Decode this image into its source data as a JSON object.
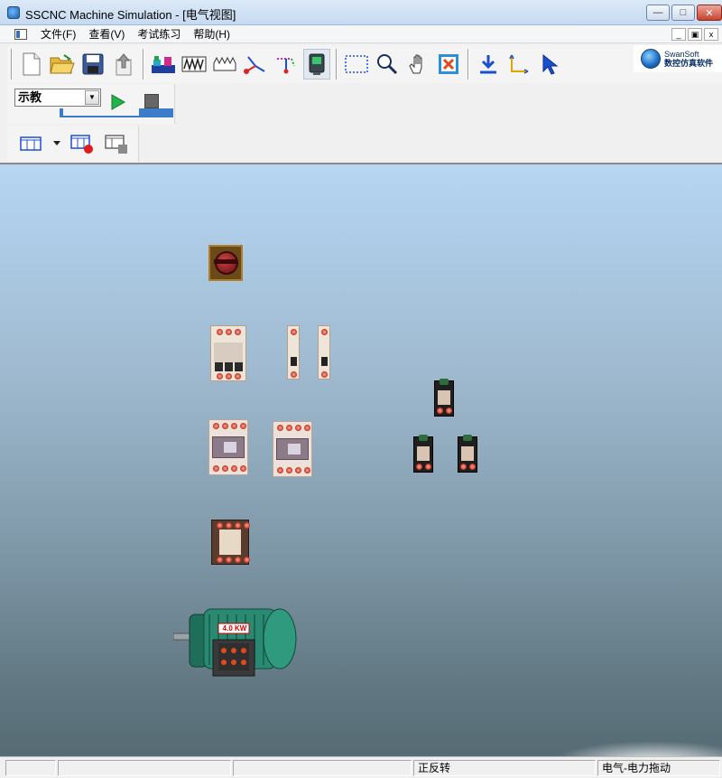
{
  "window": {
    "title": "SSCNC Machine Simulation - [电气视图]"
  },
  "menu": {
    "items": [
      "文件(F)",
      "查看(V)",
      "考试练习",
      "帮助(H)"
    ]
  },
  "brand": {
    "name": "SwanSoft",
    "subtitle": "数控仿真软件"
  },
  "mode_select": {
    "value": "示教"
  },
  "canvas": {
    "motor_power_label": "4.0 KW"
  },
  "statusbar": {
    "cells": [
      "",
      "",
      "",
      "正反转",
      "电气-电力拖动"
    ]
  },
  "colors": {
    "accent": "#3d7cc8",
    "canvas_top": "#b6d6f3",
    "canvas_bottom": "#566b74"
  },
  "icons": {
    "toolbar": [
      "new-file-icon",
      "open-folder-icon",
      "save-icon",
      "upload-icon",
      "machine-view-icon",
      "wave-icon",
      "wave-outline-icon",
      "axis-icon",
      "axis-dashed-icon",
      "controller-icon",
      "select-rect-icon",
      "zoom-icon",
      "hand-icon",
      "fit-view-icon",
      "download-icon",
      "coordinate-icon",
      "pointer-icon"
    ]
  }
}
